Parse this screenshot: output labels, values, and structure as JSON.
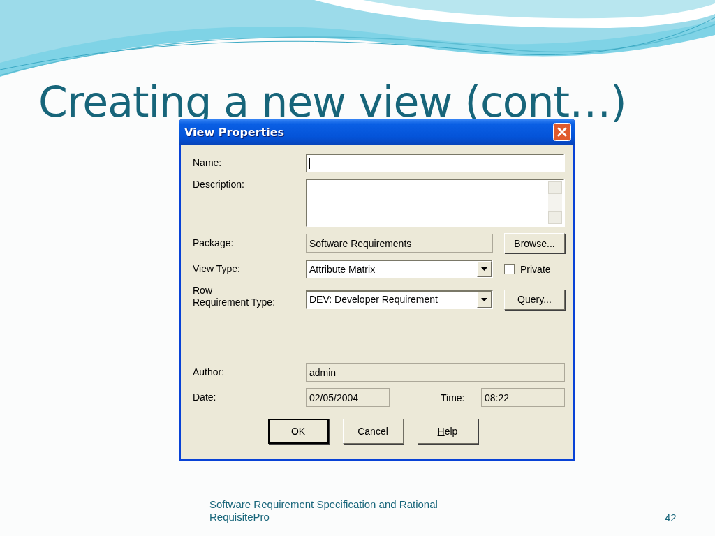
{
  "slide": {
    "title": "Creating a new view (cont…)",
    "footer": "Software Requirement Specification and Rational RequisitePro",
    "page_number": "42"
  },
  "dialog": {
    "title": "View Properties",
    "rows": [
      {
        "kind": "text",
        "label": "Name:",
        "focused": true
      },
      {
        "kind": "textarea",
        "label": "Description:"
      },
      {
        "kind": "readonly",
        "label": "Package:",
        "value": "Software Requirements",
        "button": {
          "text_before": "Bro",
          "mnemonic": "w",
          "text_after": "se..."
        }
      },
      {
        "kind": "combo",
        "label": "View Type:",
        "value": "Attribute Matrix",
        "checkbox": {
          "label": "Private",
          "checked": false
        }
      },
      {
        "kind": "combo",
        "label": "Row\nRequirement Type:",
        "value": "DEV: Developer Requirement",
        "button": {
          "label": "Query..."
        }
      },
      {
        "kind": "wide",
        "label": "Author:",
        "value": "admin"
      },
      {
        "kind": "date_time",
        "label": "Date:",
        "value": "02/05/2004",
        "time_label": "Time:",
        "time_value": "08:22"
      }
    ],
    "buttons": [
      {
        "label": "OK",
        "default": true
      },
      {
        "label": "Cancel",
        "default": false
      },
      {
        "mnemonic": "H",
        "text_after": "elp",
        "default": false
      }
    ]
  }
}
